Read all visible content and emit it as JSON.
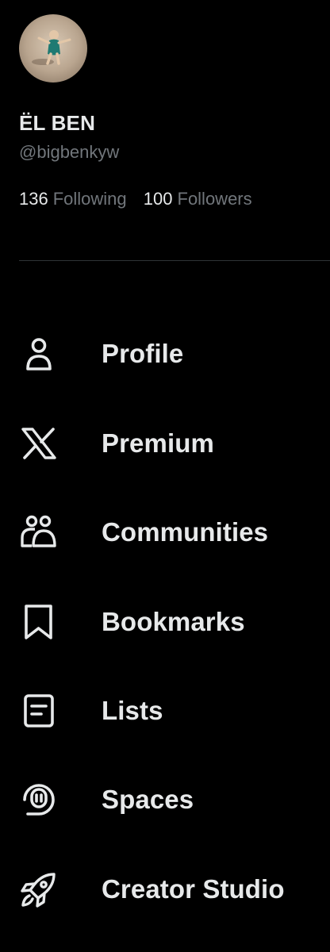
{
  "profile": {
    "display_name": "ËL BEN",
    "handle": "@bigbenkyw",
    "following_count": "136",
    "following_label": "Following",
    "followers_count": "100",
    "followers_label": "Followers"
  },
  "menu": {
    "items": [
      {
        "label": "Profile",
        "icon": "person-icon"
      },
      {
        "label": "Premium",
        "icon": "x-logo-icon"
      },
      {
        "label": "Communities",
        "icon": "communities-icon"
      },
      {
        "label": "Bookmarks",
        "icon": "bookmark-icon"
      },
      {
        "label": "Lists",
        "icon": "list-icon"
      },
      {
        "label": "Spaces",
        "icon": "spaces-icon"
      },
      {
        "label": "Creator Studio",
        "icon": "rocket-icon"
      }
    ]
  },
  "colors": {
    "background": "#000000",
    "primary_text": "#e7e9ea",
    "secondary_text": "#71767b",
    "divider": "#2f3336"
  }
}
